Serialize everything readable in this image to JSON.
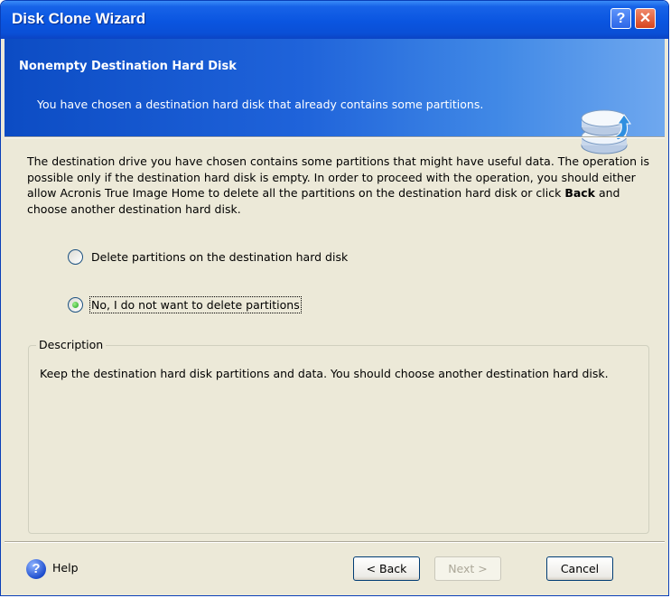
{
  "window": {
    "title": "Disk Clone Wizard",
    "help_glyph": "?",
    "close_glyph": "✕"
  },
  "banner": {
    "title": "Nonempty Destination Hard Disk",
    "subtitle": "You have chosen a destination hard disk that already contains some partitions.",
    "icon": "hard-disk-clone-icon"
  },
  "intro": {
    "part1": "The destination drive you have chosen contains some partitions that might have useful data. The operation is possible only if the destination hard disk is empty. In order to proceed with the operation, you should either allow Acronis True Image Home to delete all the partitions on the destination hard disk or click ",
    "bold": "Back",
    "part2": " and choose another destination hard disk."
  },
  "options": [
    {
      "label": "Delete partitions on the destination hard disk",
      "selected": false
    },
    {
      "label": "No, I do not want to delete partitions",
      "selected": true
    }
  ],
  "description": {
    "legend": "Description",
    "text": "Keep the destination hard disk partitions and data. You should choose another destination hard disk."
  },
  "footer": {
    "help_label": "Help",
    "back_label": "< Back",
    "next_label": "Next >",
    "cancel_label": "Cancel"
  },
  "colors": {
    "title_bar": "#0a55e0",
    "banner_start": "#0c4cc4",
    "banner_end": "#6fa8ef",
    "dialog_bg": "#ece9d8",
    "radio_selected": "#21a121"
  }
}
